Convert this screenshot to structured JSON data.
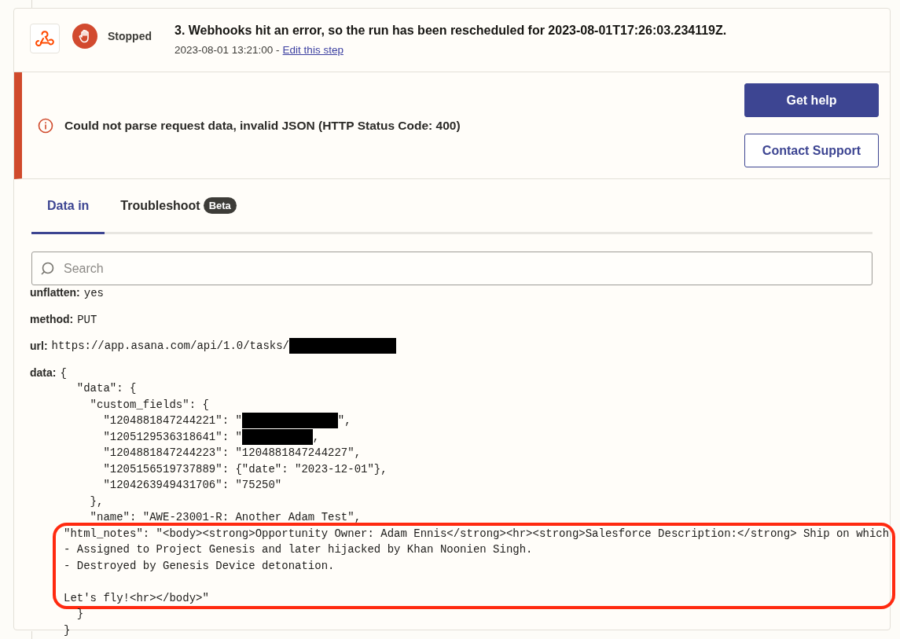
{
  "step": {
    "status": "Stopped",
    "title": "3. Webhooks hit an error, so the run has been rescheduled for 2023-08-01T17:26:03.234119Z.",
    "timestamp": "2023-08-01 13:21:00 -",
    "edit_link": "Edit this step"
  },
  "error": {
    "message": "Could not parse request data, invalid JSON (HTTP Status Code: 400)",
    "buttons": [
      {
        "label": "Get help",
        "kind": "primary"
      },
      {
        "label": "Contact Support",
        "kind": "secondary"
      }
    ]
  },
  "tabs": [
    {
      "label": "Data in",
      "selected": true
    },
    {
      "label": "Troubleshoot",
      "selected": false,
      "badge": "Beta"
    }
  ],
  "search": {
    "placeholder": "Search"
  },
  "fields": [
    {
      "label": "unflatten:",
      "segments": [
        {
          "kind": "text",
          "text": "yes"
        }
      ]
    },
    {
      "label": "method:",
      "segments": [
        {
          "kind": "text",
          "text": "PUT"
        }
      ]
    },
    {
      "label": "url:",
      "segments": [
        {
          "kind": "text",
          "text": "https://app.asana.com/api/1.0/tasks/"
        },
        {
          "kind": "redaction"
        }
      ]
    },
    {
      "label": "data:",
      "segments": [
        {
          "kind": "text",
          "text": "{"
        }
      ]
    }
  ],
  "code_lines": [
    {
      "segments": [
        {
          "kind": "text",
          "text": "  \"data\": {"
        }
      ]
    },
    {
      "segments": [
        {
          "kind": "text",
          "text": "    \"custom_fields\": {"
        }
      ]
    },
    {
      "segments": [
        {
          "kind": "text",
          "text": "      \"1204881847244221\": \""
        },
        {
          "kind": "redaction"
        },
        {
          "kind": "text",
          "text": "\","
        }
      ]
    },
    {
      "segments": [
        {
          "kind": "text",
          "text": "      \"1205129536318641\": \""
        },
        {
          "kind": "redaction"
        },
        {
          "kind": "text",
          "text": ","
        }
      ]
    },
    {
      "segments": [
        {
          "kind": "text",
          "text": "      \"1204881847244223\": \"1204881847244227\","
        }
      ]
    },
    {
      "segments": [
        {
          "kind": "text",
          "text": "      \"1205156519737889\": {\"date\": \"2023-12-01\"},"
        }
      ]
    },
    {
      "segments": [
        {
          "kind": "text",
          "text": "      \"1204263949431706\": \"75250\""
        }
      ]
    },
    {
      "segments": [
        {
          "kind": "text",
          "text": "    },"
        }
      ]
    },
    {
      "segments": [
        {
          "kind": "text",
          "text": "    \"name\": \"AWE-23001-R: Another Adam Test\","
        }
      ]
    },
    {
      "segments": [
        {
          "kind": "text",
          "text": "\"html_notes\": \"<body><strong>Opportunity Owner: Adam Ennis</strong><hr><strong>Salesforce Description:</strong> Ship on which"
        }
      ],
      "highlighted": true
    },
    {
      "segments": [
        {
          "kind": "text",
          "text": "- Assigned to Project Genesis and later hijacked by Khan Noonien Singh."
        }
      ],
      "highlighted": true
    },
    {
      "segments": [
        {
          "kind": "text",
          "text": "- Destroyed by Genesis Device detonation."
        }
      ],
      "highlighted": true
    },
    {
      "highlighted": true
    },
    {
      "segments": [
        {
          "kind": "text",
          "text": "Let's fly!<hr></body>\""
        }
      ],
      "highlighted": true
    },
    {
      "segments": [
        {
          "kind": "text",
          "text": "  }"
        }
      ]
    },
    {
      "segments": [
        {
          "kind": "text",
          "text": "}"
        }
      ]
    }
  ]
}
